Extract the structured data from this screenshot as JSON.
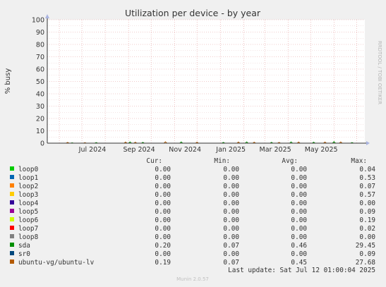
{
  "chart_data": {
    "type": "line",
    "title": "Utilization per device - by year",
    "ylabel": "% busy",
    "ylim": [
      0,
      100
    ],
    "yticks": [
      "0",
      "10",
      "20",
      "30",
      "40",
      "50",
      "60",
      "70",
      "80",
      "90",
      "100"
    ],
    "xticks": [
      "Jul 2024",
      "Sep 2024",
      "Nov 2024",
      "Jan 2025",
      "Mar 2025",
      "May 2025"
    ],
    "grid": true,
    "side_label": "RRDTOOL / TOBI OETIKER",
    "columns": [
      "Cur:",
      "Min:",
      "Avg:",
      "Max:"
    ],
    "series": [
      {
        "name": "loop0",
        "color": "#00cc00",
        "cur": "0.00",
        "min": "0.00",
        "avg": "0.00",
        "max": "0.04"
      },
      {
        "name": "loop1",
        "color": "#0066b3",
        "cur": "0.00",
        "min": "0.00",
        "avg": "0.00",
        "max": "0.53"
      },
      {
        "name": "loop2",
        "color": "#ff8000",
        "cur": "0.00",
        "min": "0.00",
        "avg": "0.00",
        "max": "0.07"
      },
      {
        "name": "loop3",
        "color": "#ffcc00",
        "cur": "0.00",
        "min": "0.00",
        "avg": "0.00",
        "max": "0.57"
      },
      {
        "name": "loop4",
        "color": "#330099",
        "cur": "0.00",
        "min": "0.00",
        "avg": "0.00",
        "max": "0.00"
      },
      {
        "name": "loop5",
        "color": "#990099",
        "cur": "0.00",
        "min": "0.00",
        "avg": "0.00",
        "max": "0.09"
      },
      {
        "name": "loop6",
        "color": "#ccff00",
        "cur": "0.00",
        "min": "0.00",
        "avg": "0.00",
        "max": "0.19"
      },
      {
        "name": "loop7",
        "color": "#ff0000",
        "cur": "0.00",
        "min": "0.00",
        "avg": "0.00",
        "max": "0.02"
      },
      {
        "name": "loop8",
        "color": "#808080",
        "cur": "0.00",
        "min": "0.00",
        "avg": "0.00",
        "max": "0.00"
      },
      {
        "name": "sda",
        "color": "#008f00",
        "cur": "0.20",
        "min": "0.07",
        "avg": "0.46",
        "max": "29.45"
      },
      {
        "name": "sr0",
        "color": "#00487d",
        "cur": "0.00",
        "min": "0.00",
        "avg": "0.00",
        "max": "0.09"
      },
      {
        "name": "ubuntu-vg/ubuntu-lv",
        "color": "#b35a00",
        "cur": "0.19",
        "min": "0.07",
        "avg": "0.45",
        "max": "27.68"
      }
    ],
    "spikes": [
      {
        "date": "2024-06-12",
        "value": 0.6
      },
      {
        "date": "2024-06-18",
        "value": 0.3
      },
      {
        "date": "2024-07-05",
        "value": 0.4
      },
      {
        "date": "2024-07-20",
        "value": 0.5
      },
      {
        "date": "2024-08-28",
        "value": 0.9
      },
      {
        "date": "2024-09-03",
        "value": 1.0
      },
      {
        "date": "2024-09-10",
        "value": 0.8
      },
      {
        "date": "2024-09-20",
        "value": 0.7
      },
      {
        "date": "2024-10-20",
        "value": 1.1
      },
      {
        "date": "2024-11-10",
        "value": 1.0
      },
      {
        "date": "2024-12-01",
        "value": 0.8
      },
      {
        "date": "2025-01-05",
        "value": 0.6
      },
      {
        "date": "2025-01-25",
        "value": 0.9
      },
      {
        "date": "2025-02-05",
        "value": 1.0
      },
      {
        "date": "2025-02-15",
        "value": 0.8
      },
      {
        "date": "2025-03-10",
        "value": 0.7
      },
      {
        "date": "2025-03-20",
        "value": 0.6
      },
      {
        "date": "2025-04-05",
        "value": 1.0
      },
      {
        "date": "2025-04-15",
        "value": 0.9
      },
      {
        "date": "2025-05-05",
        "value": 0.8
      },
      {
        "date": "2025-05-20",
        "value": 0.9
      },
      {
        "date": "2025-06-01",
        "value": 1.2
      },
      {
        "date": "2025-06-10",
        "value": 1.0
      },
      {
        "date": "2025-06-25",
        "value": 0.5
      }
    ],
    "last_update": "Last update: Sat Jul 12 01:00:04 2025",
    "footer": "Munin 2.0.57"
  }
}
